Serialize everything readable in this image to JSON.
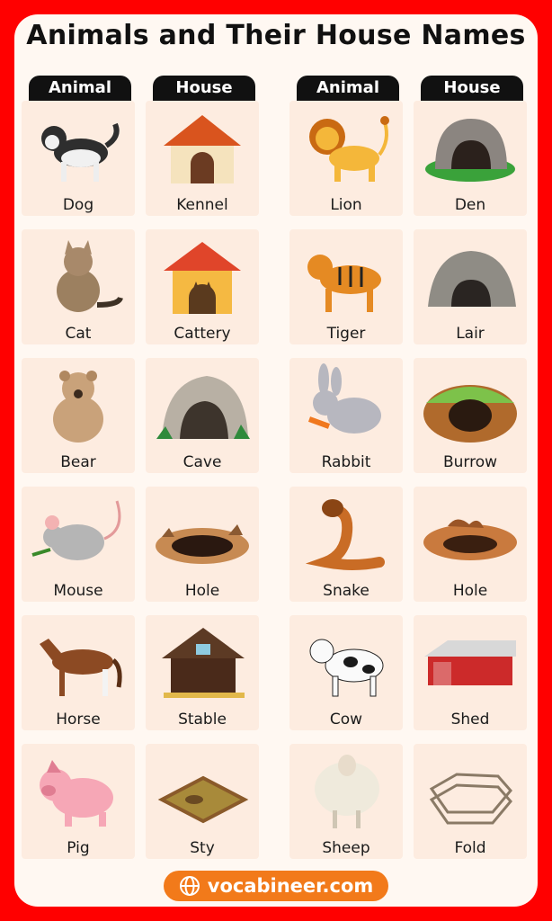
{
  "title": "Animals and Their House Names",
  "headers": [
    "Animal",
    "House",
    "Animal",
    "House"
  ],
  "rows": [
    {
      "a1": "Dog",
      "h1": "Kennel",
      "a2": "Lion",
      "h2": "Den"
    },
    {
      "a1": "Cat",
      "h1": "Cattery",
      "a2": "Tiger",
      "h2": "Lair"
    },
    {
      "a1": "Bear",
      "h1": "Cave",
      "a2": "Rabbit",
      "h2": "Burrow"
    },
    {
      "a1": "Mouse",
      "h1": "Hole",
      "a2": "Snake",
      "h2": "Hole"
    },
    {
      "a1": "Horse",
      "h1": "Stable",
      "a2": "Cow",
      "h2": "Shed"
    },
    {
      "a1": "Pig",
      "h1": "Sty",
      "a2": "Sheep",
      "h2": "Fold"
    }
  ],
  "footer": {
    "text": "vocabineer.com",
    "icon": "globe-icon"
  },
  "colors": {
    "border": "#ff0000",
    "panel": "#fff8f2",
    "cell": "#fdece0",
    "accent": "#f27a1a",
    "header": "#111111"
  }
}
